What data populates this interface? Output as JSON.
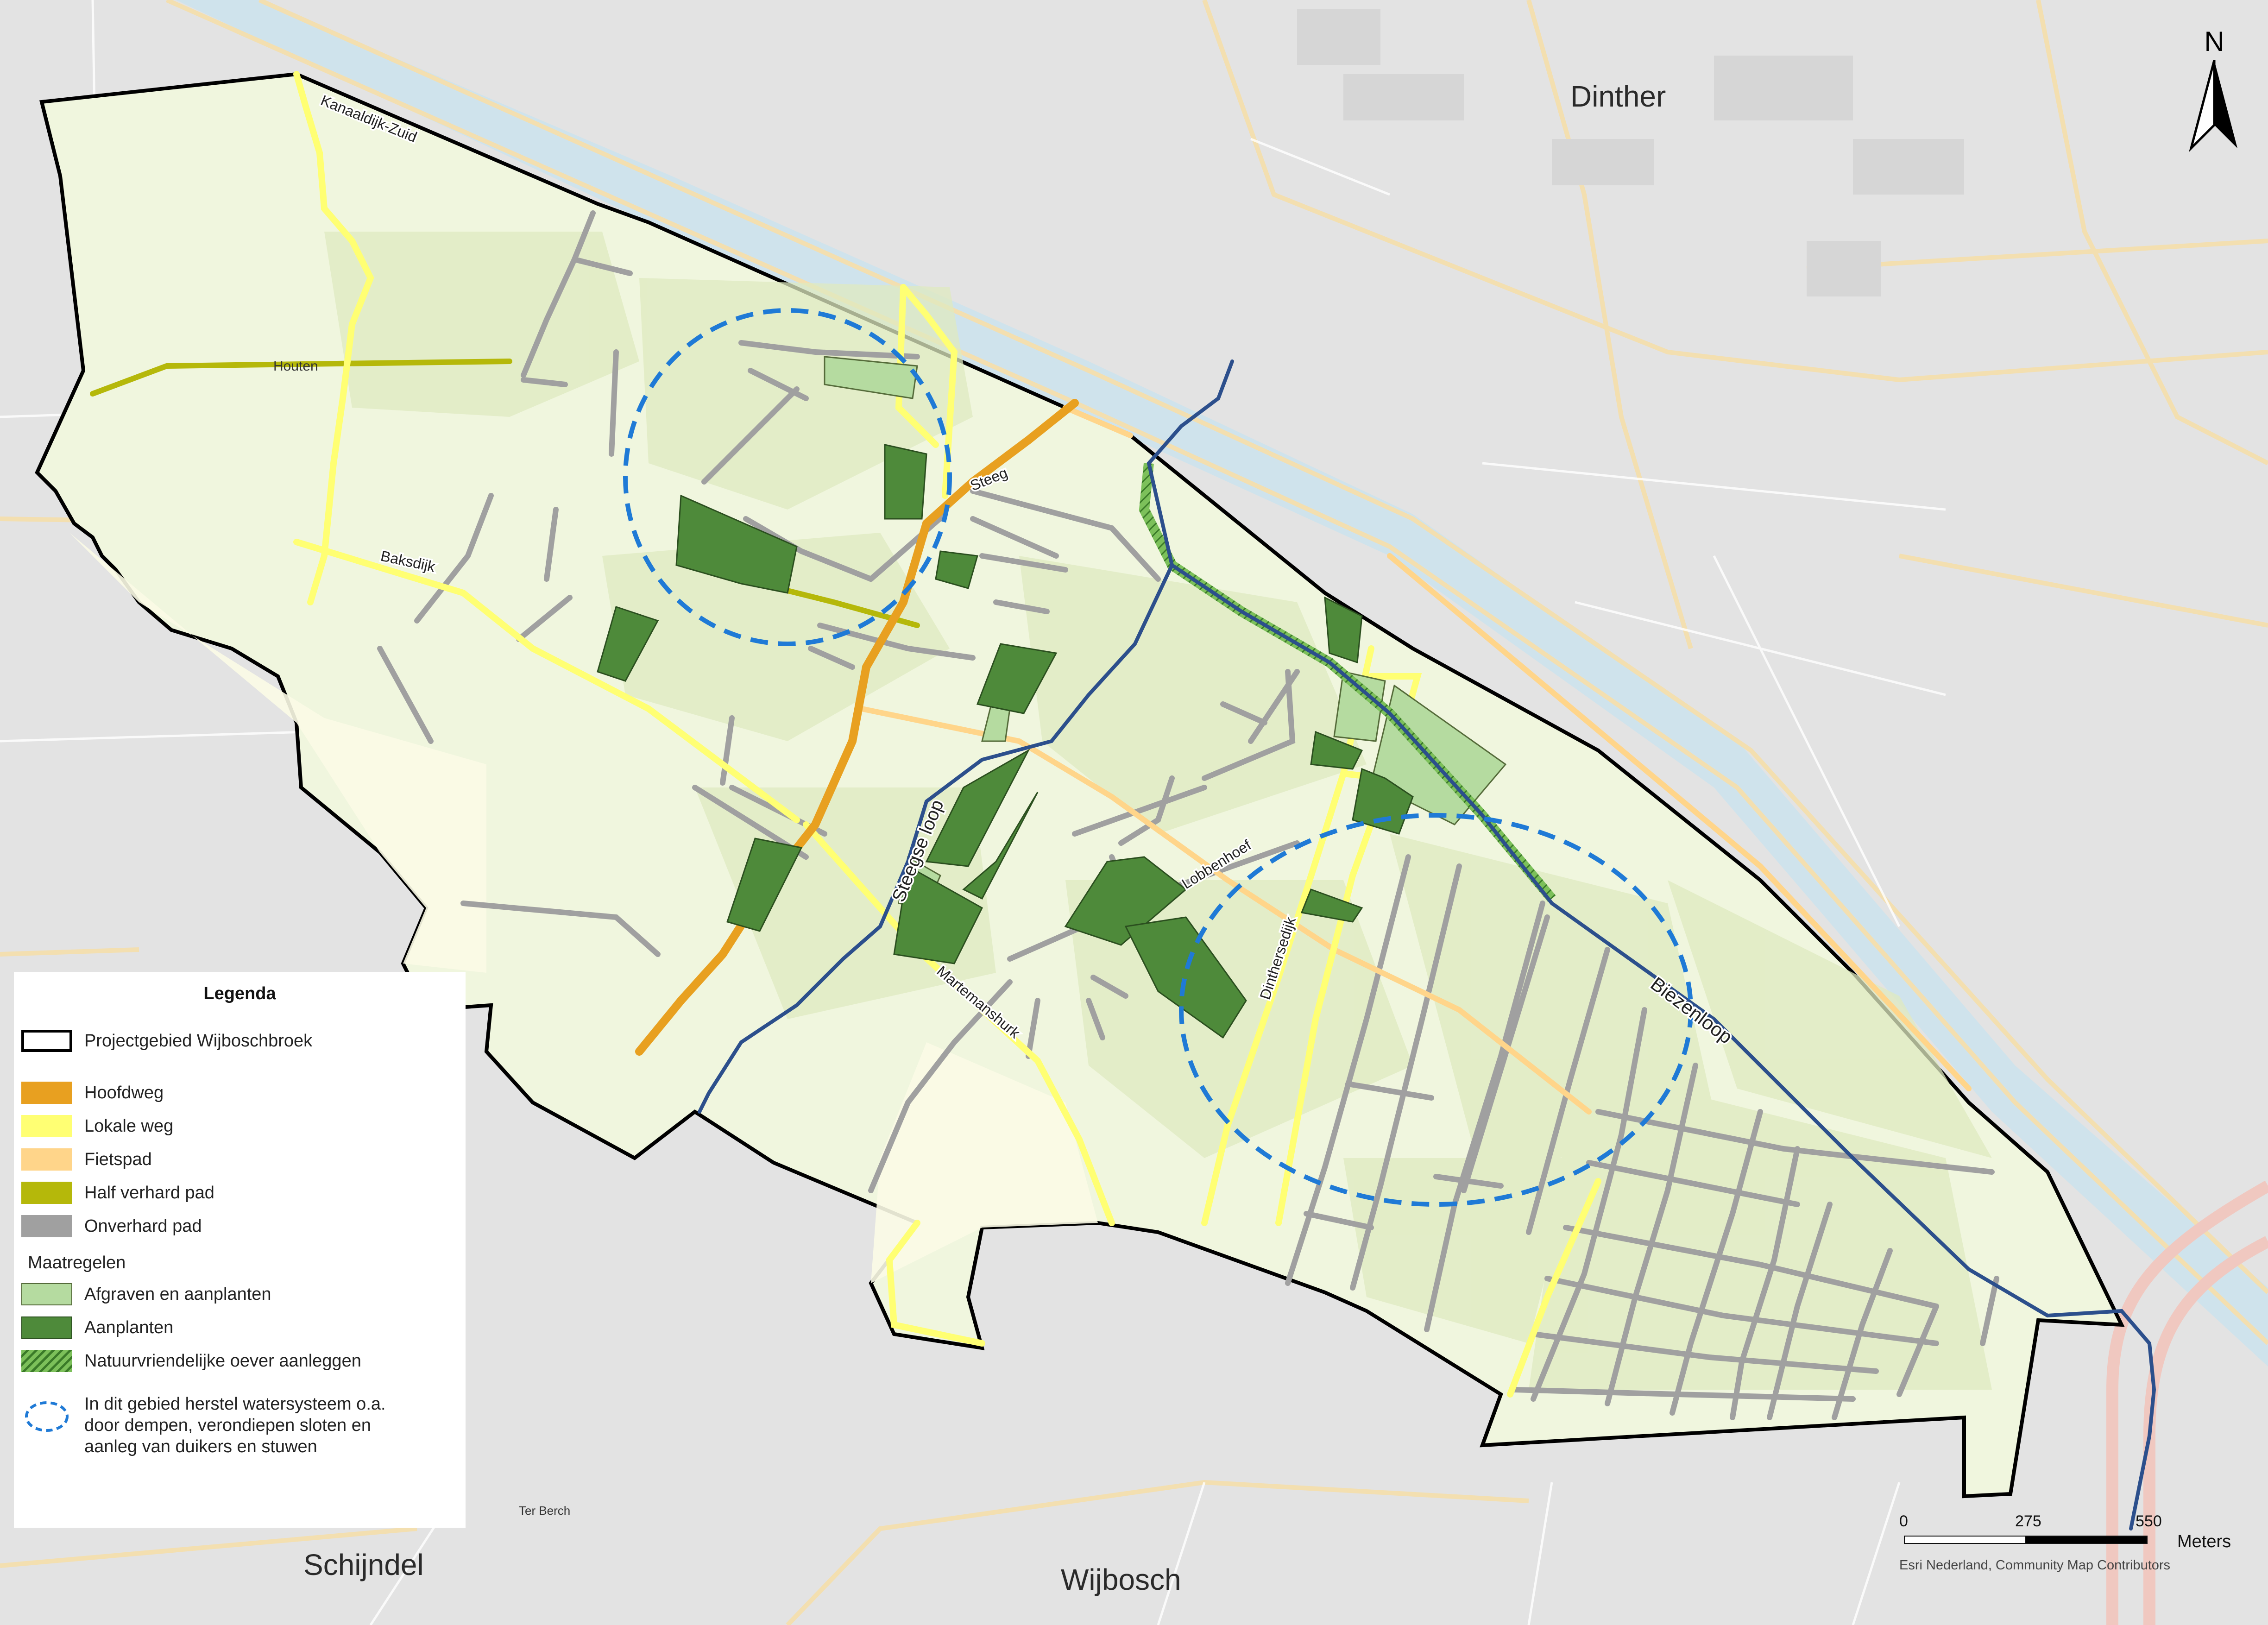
{
  "map": {
    "towns": [
      "Dinther",
      "Schijndel",
      "Wijbosch"
    ],
    "streets": [
      "Kanaaldijk-Zuid",
      "Baksdijk",
      "Steeg",
      "Steegse loop",
      "Martemanshurk",
      "Lobbenhoef",
      "Dinthersedijk",
      "Biezenloop"
    ],
    "faint_labels": [
      "Houten",
      "Ter Berch"
    ]
  },
  "legend": {
    "title": "Legenda",
    "boundary": "Projectgebied Wijboschbroek",
    "roads": [
      {
        "label": "Hoofdweg",
        "color": "#e8a020"
      },
      {
        "label": "Lokale weg",
        "color": "#ffff73"
      },
      {
        "label": "Fietspad",
        "color": "#ffd58a"
      },
      {
        "label": "Half verhard pad",
        "color": "#b5b80a"
      },
      {
        "label": "Onverhard pad",
        "color": "#a0a0a0"
      }
    ],
    "measures_title": "Maatregelen",
    "measures": [
      {
        "label": "Afgraven en aanplanten",
        "color": "#b5dba0"
      },
      {
        "label": "Aanplanten",
        "color": "#4e8a3a"
      },
      {
        "label": "Natuurvriendelijke oever aanleggen",
        "color": "#7cc05a"
      }
    ],
    "water_line1": "In dit gebied herstel watersysteem o.a.",
    "water_line2": "door dempen, verondiepen sloten en",
    "water_line3": "aanleg van duikers en stuwen"
  },
  "north": {
    "label": "N"
  },
  "scalebar": {
    "ticks": [
      "0",
      "275",
      "550"
    ],
    "units": "Meters",
    "attribution": "Esri Nederland, Community Map Contributors"
  },
  "colors": {
    "background": "#e4e4e4",
    "project_fill": "#eef4dc",
    "boundary": "#000000",
    "water_circle": "#1f7ad6",
    "watercourse": "#2c4f8c",
    "canal": "#b8d8e8"
  }
}
